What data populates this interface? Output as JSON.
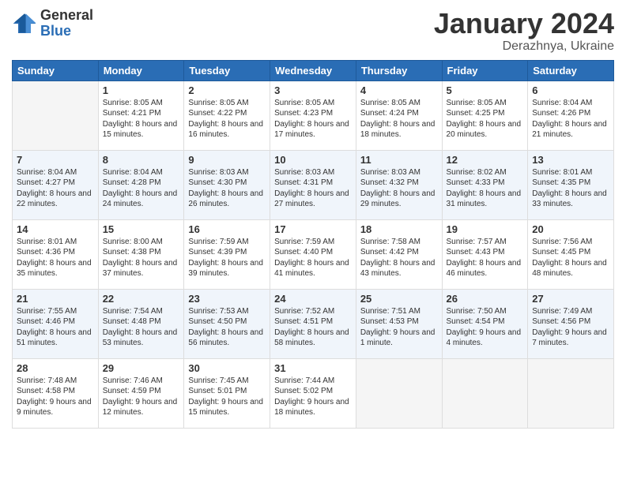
{
  "header": {
    "logo_general": "General",
    "logo_blue": "Blue",
    "month_title": "January 2024",
    "location": "Derazhnya, Ukraine"
  },
  "days_of_week": [
    "Sunday",
    "Monday",
    "Tuesday",
    "Wednesday",
    "Thursday",
    "Friday",
    "Saturday"
  ],
  "weeks": [
    [
      {
        "day": "",
        "empty": true
      },
      {
        "day": "1",
        "sunrise": "8:05 AM",
        "sunset": "4:21 PM",
        "daylight": "8 hours and 15 minutes."
      },
      {
        "day": "2",
        "sunrise": "8:05 AM",
        "sunset": "4:22 PM",
        "daylight": "8 hours and 16 minutes."
      },
      {
        "day": "3",
        "sunrise": "8:05 AM",
        "sunset": "4:23 PM",
        "daylight": "8 hours and 17 minutes."
      },
      {
        "day": "4",
        "sunrise": "8:05 AM",
        "sunset": "4:24 PM",
        "daylight": "8 hours and 18 minutes."
      },
      {
        "day": "5",
        "sunrise": "8:05 AM",
        "sunset": "4:25 PM",
        "daylight": "8 hours and 20 minutes."
      },
      {
        "day": "6",
        "sunrise": "8:04 AM",
        "sunset": "4:26 PM",
        "daylight": "8 hours and 21 minutes."
      }
    ],
    [
      {
        "day": "7",
        "sunrise": "8:04 AM",
        "sunset": "4:27 PM",
        "daylight": "8 hours and 22 minutes."
      },
      {
        "day": "8",
        "sunrise": "8:04 AM",
        "sunset": "4:28 PM",
        "daylight": "8 hours and 24 minutes."
      },
      {
        "day": "9",
        "sunrise": "8:03 AM",
        "sunset": "4:30 PM",
        "daylight": "8 hours and 26 minutes."
      },
      {
        "day": "10",
        "sunrise": "8:03 AM",
        "sunset": "4:31 PM",
        "daylight": "8 hours and 27 minutes."
      },
      {
        "day": "11",
        "sunrise": "8:03 AM",
        "sunset": "4:32 PM",
        "daylight": "8 hours and 29 minutes."
      },
      {
        "day": "12",
        "sunrise": "8:02 AM",
        "sunset": "4:33 PM",
        "daylight": "8 hours and 31 minutes."
      },
      {
        "day": "13",
        "sunrise": "8:01 AM",
        "sunset": "4:35 PM",
        "daylight": "8 hours and 33 minutes."
      }
    ],
    [
      {
        "day": "14",
        "sunrise": "8:01 AM",
        "sunset": "4:36 PM",
        "daylight": "8 hours and 35 minutes."
      },
      {
        "day": "15",
        "sunrise": "8:00 AM",
        "sunset": "4:38 PM",
        "daylight": "8 hours and 37 minutes."
      },
      {
        "day": "16",
        "sunrise": "7:59 AM",
        "sunset": "4:39 PM",
        "daylight": "8 hours and 39 minutes."
      },
      {
        "day": "17",
        "sunrise": "7:59 AM",
        "sunset": "4:40 PM",
        "daylight": "8 hours and 41 minutes."
      },
      {
        "day": "18",
        "sunrise": "7:58 AM",
        "sunset": "4:42 PM",
        "daylight": "8 hours and 43 minutes."
      },
      {
        "day": "19",
        "sunrise": "7:57 AM",
        "sunset": "4:43 PM",
        "daylight": "8 hours and 46 minutes."
      },
      {
        "day": "20",
        "sunrise": "7:56 AM",
        "sunset": "4:45 PM",
        "daylight": "8 hours and 48 minutes."
      }
    ],
    [
      {
        "day": "21",
        "sunrise": "7:55 AM",
        "sunset": "4:46 PM",
        "daylight": "8 hours and 51 minutes."
      },
      {
        "day": "22",
        "sunrise": "7:54 AM",
        "sunset": "4:48 PM",
        "daylight": "8 hours and 53 minutes."
      },
      {
        "day": "23",
        "sunrise": "7:53 AM",
        "sunset": "4:50 PM",
        "daylight": "8 hours and 56 minutes."
      },
      {
        "day": "24",
        "sunrise": "7:52 AM",
        "sunset": "4:51 PM",
        "daylight": "8 hours and 58 minutes."
      },
      {
        "day": "25",
        "sunrise": "7:51 AM",
        "sunset": "4:53 PM",
        "daylight": "9 hours and 1 minute."
      },
      {
        "day": "26",
        "sunrise": "7:50 AM",
        "sunset": "4:54 PM",
        "daylight": "9 hours and 4 minutes."
      },
      {
        "day": "27",
        "sunrise": "7:49 AM",
        "sunset": "4:56 PM",
        "daylight": "9 hours and 7 minutes."
      }
    ],
    [
      {
        "day": "28",
        "sunrise": "7:48 AM",
        "sunset": "4:58 PM",
        "daylight": "9 hours and 9 minutes."
      },
      {
        "day": "29",
        "sunrise": "7:46 AM",
        "sunset": "4:59 PM",
        "daylight": "9 hours and 12 minutes."
      },
      {
        "day": "30",
        "sunrise": "7:45 AM",
        "sunset": "5:01 PM",
        "daylight": "9 hours and 15 minutes."
      },
      {
        "day": "31",
        "sunrise": "7:44 AM",
        "sunset": "5:02 PM",
        "daylight": "9 hours and 18 minutes."
      },
      {
        "day": "",
        "empty": true
      },
      {
        "day": "",
        "empty": true
      },
      {
        "day": "",
        "empty": true
      }
    ]
  ]
}
